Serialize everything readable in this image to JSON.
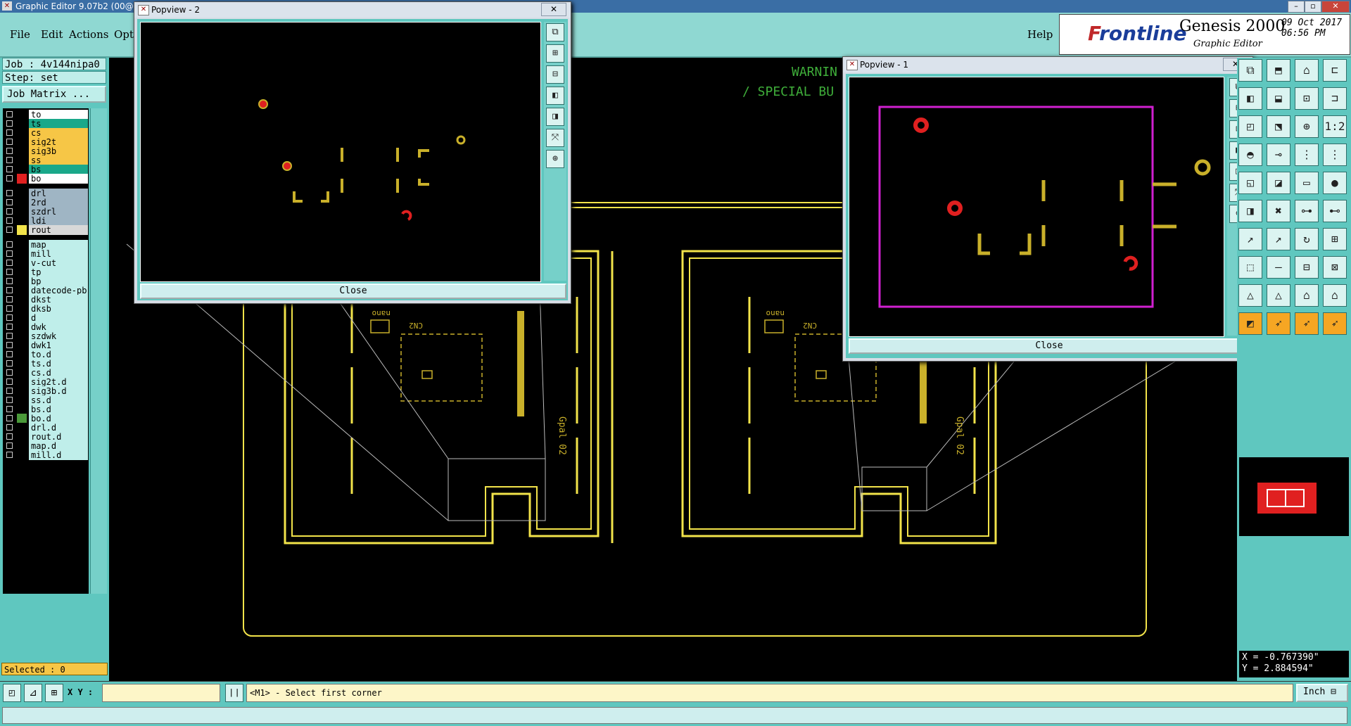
{
  "window": {
    "title": "Graphic Editor 9.07b2 (00@H"
  },
  "menu": {
    "file": "File",
    "edit": "Edit",
    "actions": "Actions",
    "options": "Opti",
    "help": "Help"
  },
  "branding": {
    "logo_prefix": "F",
    "logo_rest": "rontline",
    "product": "Genesis 2000",
    "subtitle": "Graphic Editor",
    "date": "09 Oct 2017",
    "time": "06:56 PM"
  },
  "job": {
    "job_label": "Job : 4v144nipa0",
    "step_label": "Step: set",
    "matrix_button": "Job Matrix ..."
  },
  "layers": [
    {
      "name": "to",
      "color": "#ffffff",
      "swatch": ""
    },
    {
      "name": "ts",
      "color": "#1aa88a",
      "swatch": ""
    },
    {
      "name": "cs",
      "color": "#f6c646",
      "swatch": ""
    },
    {
      "name": "sig2t",
      "color": "#f6c646",
      "swatch": ""
    },
    {
      "name": "sig3b",
      "color": "#f6c646",
      "swatch": ""
    },
    {
      "name": "ss",
      "color": "#f6c646",
      "swatch": ""
    },
    {
      "name": "bs",
      "color": "#1aa88a",
      "swatch": ""
    },
    {
      "name": "bo",
      "color": "#ffffff",
      "swatch": "#e02020"
    },
    {
      "name": "drl",
      "color": "#9fb5c4",
      "swatch": ""
    },
    {
      "name": "2rd",
      "color": "#9fb5c4",
      "swatch": ""
    },
    {
      "name": "szdrl",
      "color": "#9fb5c4",
      "swatch": ""
    },
    {
      "name": "ldi",
      "color": "#9fb5c4",
      "swatch": ""
    },
    {
      "name": "rout",
      "color": "#d8d8d8",
      "swatch": "#f2e34a"
    },
    {
      "name": "map",
      "color": "#bfeeea",
      "swatch": ""
    },
    {
      "name": "mill",
      "color": "#bfeeea",
      "swatch": ""
    },
    {
      "name": "v-cut",
      "color": "#bfeeea",
      "swatch": ""
    },
    {
      "name": "tp",
      "color": "#bfeeea",
      "swatch": ""
    },
    {
      "name": "bp",
      "color": "#bfeeea",
      "swatch": ""
    },
    {
      "name": "datecode-pb",
      "color": "#bfeeea",
      "swatch": ""
    },
    {
      "name": "dkst",
      "color": "#bfeeea",
      "swatch": ""
    },
    {
      "name": "dksb",
      "color": "#bfeeea",
      "swatch": ""
    },
    {
      "name": "d",
      "color": "#bfeeea",
      "swatch": ""
    },
    {
      "name": "dwk",
      "color": "#bfeeea",
      "swatch": ""
    },
    {
      "name": "szdwk",
      "color": "#bfeeea",
      "swatch": ""
    },
    {
      "name": "dwk1",
      "color": "#bfeeea",
      "swatch": ""
    },
    {
      "name": "to.d",
      "color": "#bfeeea",
      "swatch": ""
    },
    {
      "name": "ts.d",
      "color": "#bfeeea",
      "swatch": ""
    },
    {
      "name": "cs.d",
      "color": "#bfeeea",
      "swatch": ""
    },
    {
      "name": "sig2t.d",
      "color": "#bfeeea",
      "swatch": ""
    },
    {
      "name": "sig3b.d",
      "color": "#bfeeea",
      "swatch": ""
    },
    {
      "name": "ss.d",
      "color": "#bfeeea",
      "swatch": ""
    },
    {
      "name": "bs.d",
      "color": "#bfeeea",
      "swatch": ""
    },
    {
      "name": "bo.d",
      "color": "#bfeeea",
      "swatch": "#4a9a3a"
    },
    {
      "name": "drl.d",
      "color": "#bfeeea",
      "swatch": ""
    },
    {
      "name": "rout.d",
      "color": "#bfeeea",
      "swatch": ""
    },
    {
      "name": "map.d",
      "color": "#bfeeea",
      "swatch": ""
    },
    {
      "name": "mill.d",
      "color": "#bfeeea",
      "swatch": ""
    }
  ],
  "selected": "Selected : 0",
  "canvas_text": {
    "warning": "WARNIN",
    "special": "/ SPECIAL BU",
    "nano": "nano",
    "cn2": "CN2",
    "part": "Gpal 02"
  },
  "popview2": {
    "title": "Popview - 2",
    "close": "Close",
    "close_x": "✕"
  },
  "popview1": {
    "title": "Popview - 1",
    "close": "Close",
    "close_x": "✕"
  },
  "coords": {
    "x": "X = -0.767390\"",
    "y": "Y = 2.884594\""
  },
  "command": {
    "xy_label": "X Y :",
    "xy_value": "",
    "message": "<M1> - Select first corner",
    "unit": "Inch ⊟"
  },
  "colors": {
    "teal": "#5fc7bf",
    "outline": "#f2e34a",
    "pad": "#c9b02a",
    "drill": "#e02020",
    "magenta": "#d020d0"
  }
}
